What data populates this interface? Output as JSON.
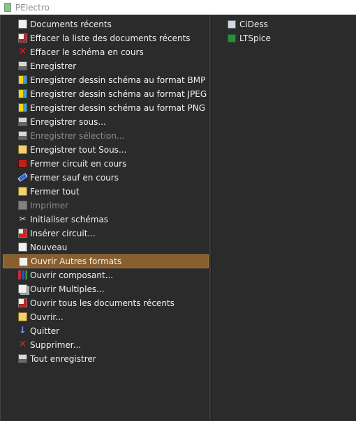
{
  "window": {
    "title": "PElectro"
  },
  "left_menu": {
    "items": [
      {
        "label": "Documents récents",
        "icon": "recent-documents-icon",
        "disabled": false,
        "selected": false
      },
      {
        "label": "Effacer la liste des documents récents",
        "icon": "clear-list-icon",
        "disabled": false,
        "selected": false
      },
      {
        "label": "Effacer le schéma en cours",
        "icon": "delete-x-icon",
        "disabled": false,
        "selected": false
      },
      {
        "label": "Enregistrer",
        "icon": "save-icon",
        "disabled": false,
        "selected": false
      },
      {
        "label": "Enregistrer dessin schéma au format BMP",
        "icon": "image-export-icon",
        "disabled": false,
        "selected": false
      },
      {
        "label": "Enregistrer dessin schéma au format JPEG",
        "icon": "image-export-icon",
        "disabled": false,
        "selected": false
      },
      {
        "label": "Enregistrer dessin schéma au format PNG",
        "icon": "image-export-icon",
        "disabled": false,
        "selected": false
      },
      {
        "label": "Enregistrer sous...",
        "icon": "save-as-icon",
        "disabled": false,
        "selected": false
      },
      {
        "label": "Enregistrer sélection...",
        "icon": "save-selection-icon",
        "disabled": true,
        "selected": false
      },
      {
        "label": "Enregistrer tout Sous...",
        "icon": "save-all-as-icon",
        "disabled": false,
        "selected": false
      },
      {
        "label": "Fermer circuit en cours",
        "icon": "close-circuit-icon",
        "disabled": false,
        "selected": false
      },
      {
        "label": "Fermer sauf en cours",
        "icon": "close-others-icon",
        "disabled": false,
        "selected": false
      },
      {
        "label": "Fermer tout",
        "icon": "close-all-icon",
        "disabled": false,
        "selected": false
      },
      {
        "label": "Imprimer",
        "icon": "printer-icon",
        "disabled": true,
        "selected": false
      },
      {
        "label": "Initialiser schémas",
        "icon": "tools-icon",
        "disabled": false,
        "selected": false
      },
      {
        "label": "Insérer circuit...",
        "icon": "insert-circuit-icon",
        "disabled": false,
        "selected": false
      },
      {
        "label": "Nouveau",
        "icon": "new-document-icon",
        "disabled": false,
        "selected": false
      },
      {
        "label": "Ouvrir Autres formats",
        "icon": "open-other-formats-icon",
        "disabled": false,
        "selected": true
      },
      {
        "label": "Ouvrir composant...",
        "icon": "open-component-icon",
        "disabled": false,
        "selected": false
      },
      {
        "label": "Ouvrir Multiples...",
        "icon": "open-multiple-icon",
        "disabled": false,
        "selected": false
      },
      {
        "label": "Ouvrir tous les documents récents",
        "icon": "open-all-recent-icon",
        "disabled": false,
        "selected": false
      },
      {
        "label": "Ouvrir...",
        "icon": "open-folder-icon",
        "disabled": false,
        "selected": false
      },
      {
        "label": "Quitter",
        "icon": "quit-arrow-icon",
        "disabled": false,
        "selected": false
      },
      {
        "label": "Supprimer...",
        "icon": "delete-x-icon",
        "disabled": false,
        "selected": false
      },
      {
        "label": "Tout enregistrer",
        "icon": "save-all-icon",
        "disabled": false,
        "selected": false
      }
    ]
  },
  "right_menu": {
    "items": [
      {
        "label": "CiDess",
        "icon": "cidess-icon"
      },
      {
        "label": "LTSpice",
        "icon": "ltspice-icon"
      }
    ]
  },
  "colors": {
    "background": "#2b2b2b",
    "selected": "#8a5f30",
    "disabled_text": "#8d8d8d"
  }
}
